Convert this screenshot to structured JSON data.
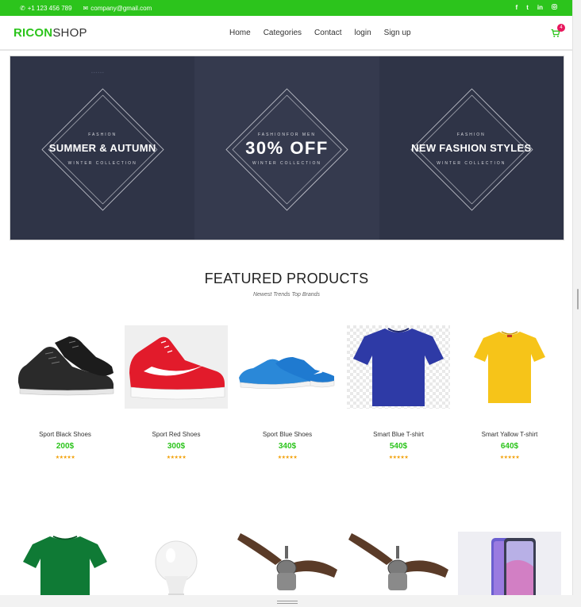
{
  "topbar": {
    "phone": "+1 123 456 789",
    "email": "company@gmail.com",
    "social": [
      "f",
      "t",
      "in",
      "ig"
    ]
  },
  "logo": {
    "part1": "RICON",
    "part2": "SHOP"
  },
  "nav": [
    "Home",
    "Categories",
    "Contact",
    "login",
    "Sign up"
  ],
  "cart": {
    "count": "4"
  },
  "banner": [
    {
      "top": "FASHION",
      "main": "SUMMER & AUTUMN",
      "bottom": "WINTER COLLECTION"
    },
    {
      "top": "FASHIONFOR MEN",
      "main": "30% OFF",
      "bottom": "WINTER COLLECTION"
    },
    {
      "top": "FASHION",
      "main": "NEW FASHION STYLES",
      "bottom": "WINTER COLLECTION"
    }
  ],
  "section": {
    "title": "FEATURED PRODUCTS",
    "subtitle": "Newest Trends Top Brands"
  },
  "products": [
    {
      "name": "Sport Black Shoes",
      "price": "200$",
      "stars": "★★★★★"
    },
    {
      "name": "Sport Red Shoes",
      "price": "300$",
      "stars": "★★★★★"
    },
    {
      "name": "Sport Blue Shoes",
      "price": "340$",
      "stars": "★★★★★"
    },
    {
      "name": "Smart Blue T-shirt",
      "price": "540$",
      "stars": "★★★★★"
    },
    {
      "name": "Smart Yallow T-shirt",
      "price": "640$",
      "stars": "★★★★★"
    }
  ],
  "colors": {
    "accent": "#2cc41c",
    "banner": "#2f3447",
    "price": "#2cc41c",
    "star": "#f29f05",
    "badge": "#e8175d"
  }
}
